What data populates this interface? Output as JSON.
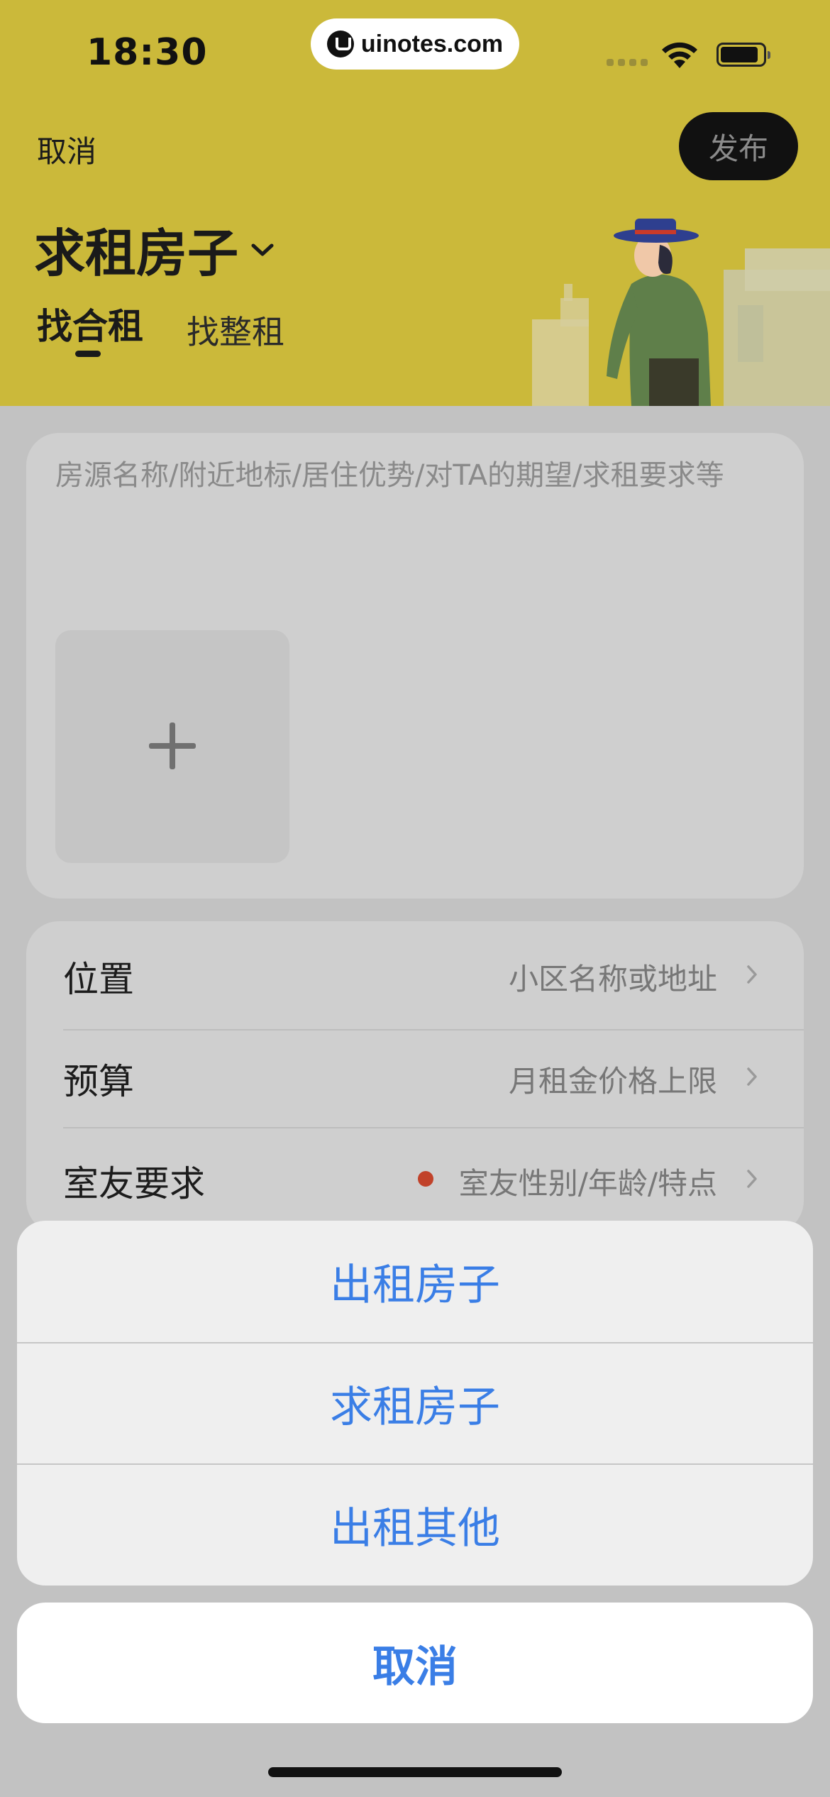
{
  "status_bar": {
    "time": "18:30",
    "watermark": "uinotes.com"
  },
  "header": {
    "cancel_label": "取消",
    "publish_label": "发布",
    "title": "求租房子",
    "tabs": [
      {
        "label": "找合租",
        "active": true
      },
      {
        "label": "找整租",
        "active": false
      }
    ],
    "background_color": "#cbb93a"
  },
  "description": {
    "placeholder": "房源名称/附近地标/居住优势/对TA的期望/求租要求等"
  },
  "form": {
    "rows": [
      {
        "label": "位置",
        "value": "小区名称或地址",
        "required_dot": false
      },
      {
        "label": "预算",
        "value": "月租金价格上限",
        "required_dot": false
      },
      {
        "label": "室友要求",
        "value": "室友性别/年龄/特点",
        "required_dot": true
      }
    ]
  },
  "action_sheet": {
    "options": [
      "出租房子",
      "求租房子",
      "出租其他"
    ],
    "cancel_label": "取消",
    "accent_color": "#3a7ee6"
  }
}
